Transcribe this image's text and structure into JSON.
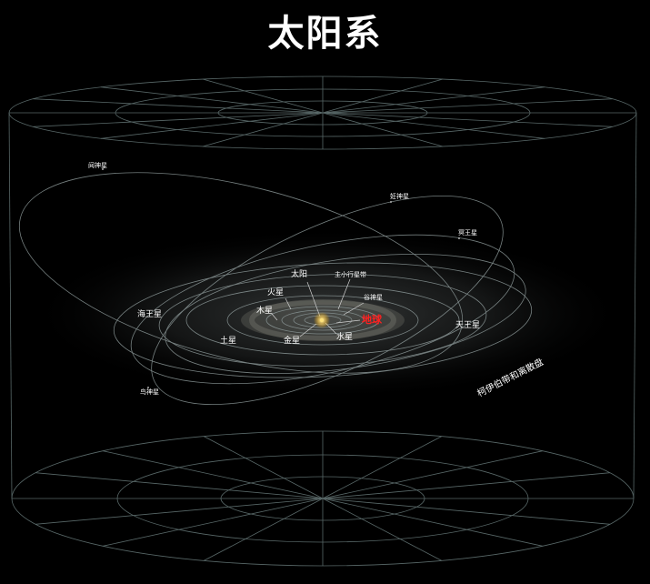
{
  "title": "太阳系",
  "labels": {
    "sun": "太阳",
    "asteroid_belt": "主小行星带",
    "mars": "火星",
    "ceres": "谷神星",
    "jupiter": "木星",
    "earth": "地球",
    "neptune": "海王星",
    "uranus": "天王星",
    "saturn": "土星",
    "venus": "金星",
    "mercury": "水星",
    "kuiper_belt": "柯伊伯带和离散盘",
    "haumea": "鸟神星",
    "makemake": "妊神星",
    "pluto": "冥王星",
    "eris": "阋神星"
  },
  "colors": {
    "background": "#000000",
    "grid_lines": "#6f8282",
    "orbit_lines": "#8a9696",
    "earth_label": "#ff2020",
    "sun": "#ffe27a"
  }
}
